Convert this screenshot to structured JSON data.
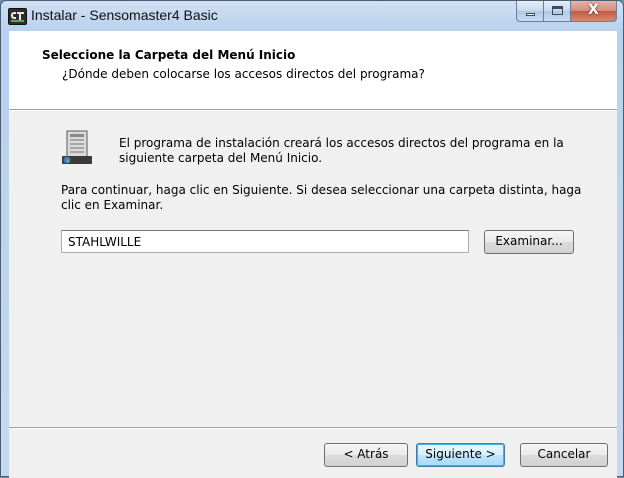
{
  "window": {
    "title": "Instalar - Sensomaster4 Basic",
    "icon": "app-icon",
    "caption_buttons": [
      "minimize-icon",
      "maximize-icon",
      "close-icon"
    ],
    "close_glyph": "X"
  },
  "header": {
    "title": "Seleccione la Carpeta del Menú Inicio",
    "subtitle": "¿Dónde deben colocarse los accesos directos del programa?"
  },
  "body": {
    "info_icon": "start-menu-folder-icon",
    "info_text": "El programa de instalación creará los accesos directos del programa en la siguiente carpeta del Menú Inicio.",
    "continue_text": "Para continuar, haga clic en Siguiente. Si desea seleccionar una carpeta distinta, haga clic en Examinar.",
    "folder_value": "STAHLWILLE",
    "browse_label": "Examinar..."
  },
  "footer": {
    "back_label": "< Atrás",
    "next_label": "Siguiente >",
    "cancel_label": "Cancelar"
  },
  "colors": {
    "frame": "#b9d1ec",
    "client": "#f0f0f0",
    "header_bg": "#ffffff",
    "close_button": "#c15c43",
    "default_button_border": "#3c7fb1"
  }
}
